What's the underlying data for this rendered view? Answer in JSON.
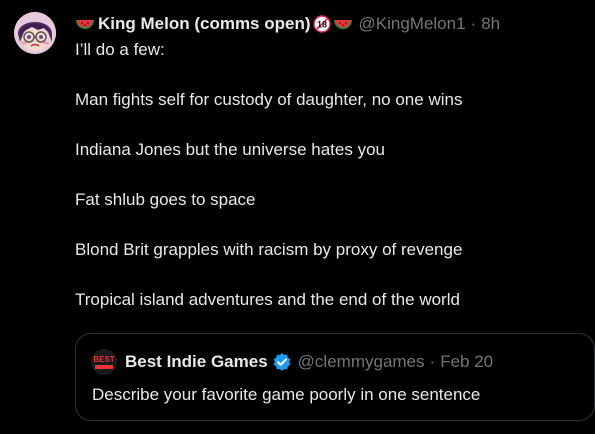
{
  "tweet": {
    "display_name": "King Melon (comms open)",
    "age_badge": "18",
    "handle": "@KingMelon1",
    "separator": "·",
    "time": "8h",
    "lines": [
      "I’ll do a few:",
      "Man fights self for custody of daughter, no one wins",
      "Indiana Jones but the universe hates you",
      "Fat shlub goes to space",
      "Blond Brit grapples with racism by proxy of revenge",
      "Tropical island adventures and the end of the world"
    ]
  },
  "quote": {
    "display_name": "Best Indie Games",
    "avatar_text": "BEST",
    "handle": "@clemmygames",
    "separator": "·",
    "time": "Feb 20",
    "text": "Describe your favorite game poorly in one sentence"
  },
  "icons": {
    "watermelon": "watermelon-icon",
    "age": "age-18-icon",
    "verified": "verified-badge-icon"
  },
  "colors": {
    "background": "#000000",
    "text_primary": "#e7e9ea",
    "text_secondary": "#71767b",
    "border": "#2f3336",
    "verified_blue": "#1d9bf0"
  }
}
